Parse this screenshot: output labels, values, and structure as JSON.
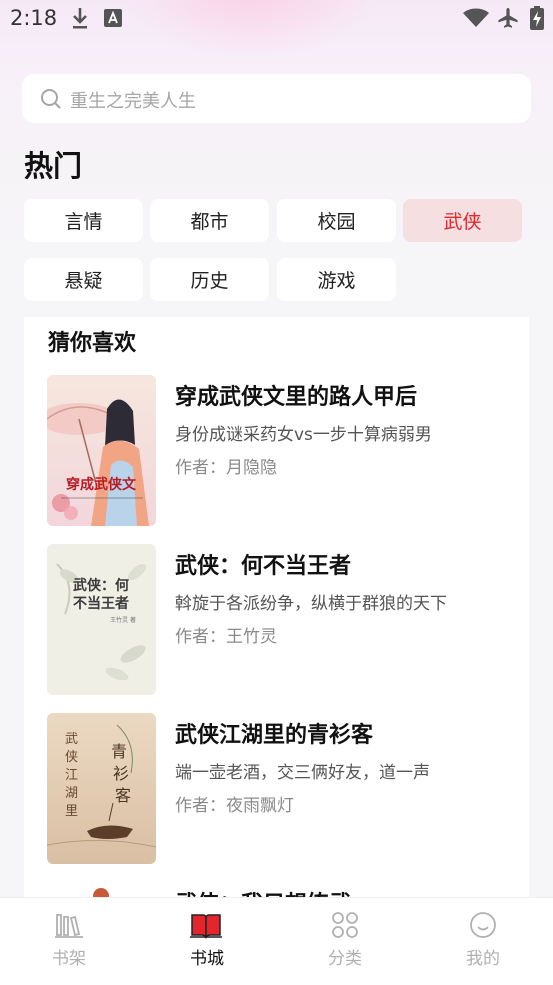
{
  "status_bar": {
    "time": "2:18"
  },
  "search": {
    "placeholder": "重生之完美人生"
  },
  "hot": {
    "title": "热门",
    "tags": [
      "言情",
      "都市",
      "校园",
      "武侠",
      "悬疑",
      "历史",
      "游戏"
    ],
    "active_tag": "武侠"
  },
  "recommend": {
    "title": "猜你喜欢",
    "books": [
      {
        "title": "穿成武侠文里的路人甲后",
        "desc": "身份成谜采药女vs一步十算病弱男",
        "author": "作者：月隐隐",
        "cover_text": "穿成武侠文"
      },
      {
        "title": "武侠：何不当王者",
        "desc": "斡旋于各派纷争，纵横于群狼的天下",
        "author": "作者：王竹灵",
        "cover_text": "武侠：何不当王者"
      },
      {
        "title": "武侠江湖里的青衫客",
        "desc": "端一壶老酒，交三俩好友，道一声",
        "author": "作者：夜雨飘灯",
        "cover_text": "青衫客"
      },
      {
        "title": "武侠：我只想练武",
        "desc": "",
        "author": ""
      }
    ]
  },
  "tabbar": {
    "items": [
      {
        "label": "书架",
        "icon": "bookshelf-icon"
      },
      {
        "label": "书城",
        "icon": "bookstore-icon"
      },
      {
        "label": "分类",
        "icon": "category-icon"
      },
      {
        "label": "我的",
        "icon": "profile-icon"
      }
    ],
    "active": "书城"
  },
  "colors": {
    "accent": "#e3252d",
    "active_tag_bg": "#f6dfe1"
  }
}
